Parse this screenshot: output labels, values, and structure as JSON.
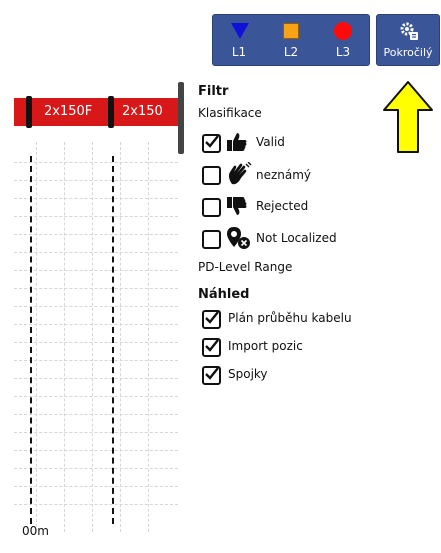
{
  "toolbar": {
    "phases": [
      {
        "label": "L1",
        "icon": "blue-triangle-icon",
        "color": "#1010d8"
      },
      {
        "label": "L2",
        "icon": "orange-square-icon",
        "color": "#f6a416"
      },
      {
        "label": "L3",
        "icon": "red-circle-icon",
        "color": "#ff0a0a"
      }
    ],
    "advanced_label": "Pokročilý",
    "advanced_icon": "gear-icon"
  },
  "plot": {
    "cable_labels": [
      "2x150F",
      "2x150"
    ],
    "axis_label": "00m",
    "cable_color": "#d81818"
  },
  "filter": {
    "title": "Filtr",
    "classification_label": "Klasifikace",
    "items": [
      {
        "label": "Valid",
        "checked": true,
        "icon": "thumbs-up-icon"
      },
      {
        "label": "neznámý",
        "checked": false,
        "icon": "waving-hand-icon"
      },
      {
        "label": "Rejected",
        "checked": false,
        "icon": "thumbs-down-icon"
      },
      {
        "label": "Not Localized",
        "checked": false,
        "icon": "location-x-icon"
      }
    ],
    "pd_range_label": "PD-Level Range"
  },
  "preview": {
    "title": "Náhled",
    "items": [
      {
        "label": "Plán průběhu kabelu",
        "checked": true
      },
      {
        "label": "Import pozic",
        "checked": true
      },
      {
        "label": "Spojky",
        "checked": true
      }
    ]
  },
  "annotation": {
    "arrow_color": "#ffff00"
  }
}
